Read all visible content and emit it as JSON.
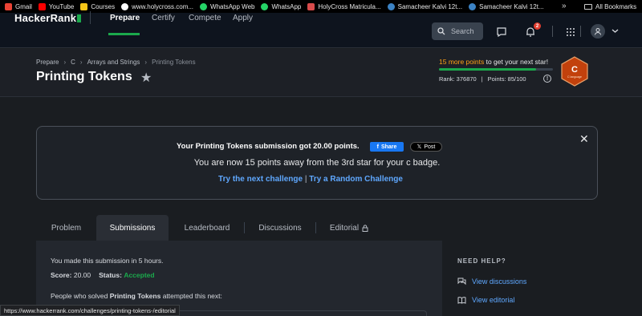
{
  "bookmarks": {
    "items": [
      "Gmail",
      "YouTube",
      "Courses",
      "www.holycross.com...",
      "WhatsApp Web",
      "WhatsApp",
      "HolyCross Matricula...",
      "Samacheer Kalvi 12t...",
      "Samacheer Kalvi 12t..."
    ],
    "more": "»",
    "all": "All Bookmarks"
  },
  "nav": {
    "logo": "HackerRank",
    "items": [
      "Prepare",
      "Certify",
      "Compete",
      "Apply"
    ],
    "search_placeholder": "Search",
    "notification_count": "2"
  },
  "header": {
    "breadcrumbs": [
      "Prepare",
      "C",
      "Arrays and Strings",
      "Printing Tokens"
    ],
    "title": "Printing Tokens",
    "points_highlight": "15 more points",
    "points_rest": " to get your next star!",
    "progress": 0.85,
    "rank": "Rank: 376870",
    "points": "Points: 85/100",
    "badge_letter": "C",
    "badge_sub": "C language"
  },
  "banner": {
    "line1": "Your Printing Tokens submission got 20.00 points.",
    "share_label": "Share",
    "post_label": "Post",
    "line2": "You are now 15 points away from the 3rd star for your c badge.",
    "link_next": "Try the next challenge",
    "pipe": "|",
    "link_random": "Try a Random Challenge"
  },
  "tabs": [
    "Problem",
    "Submissions",
    "Leaderboard",
    "Discussions",
    "Editorial"
  ],
  "submission": {
    "line1": "You made this submission in 5 hours.",
    "score_label": "Score:",
    "score_value": "20.00",
    "status_label": "Status:",
    "status_value": "Accepted",
    "line3_prefix": "People who solved ",
    "line3_bold": "Printing Tokens",
    "line3_suffix": " attempted this next:"
  },
  "help": {
    "heading": "NEED HELP?",
    "items": [
      "View discussions",
      "View editorial"
    ]
  },
  "status_url": "https://www.hackerrank.com/challenges/printing-tokens-/editorial",
  "colors": {
    "accent_green": "#1ba94c",
    "link_blue": "#5fa8ff",
    "orange": "#ffa116",
    "badge_orange": "#c2410c"
  }
}
